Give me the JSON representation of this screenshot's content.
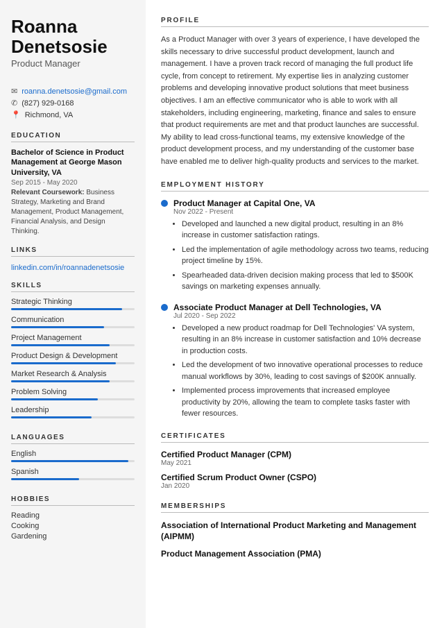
{
  "sidebar": {
    "name": "Roanna Denetsosie",
    "first_name": "Roanna",
    "last_name": "Denetsosie",
    "title": "Product Manager",
    "contact": {
      "email": "roanna.denetsosie@gmail.com",
      "phone": "(827) 929-0168",
      "location": "Richmond, VA"
    },
    "education_title": "EDUCATION",
    "education": {
      "degree": "Bachelor of Science in Product Management at George Mason University, VA",
      "dates": "Sep 2015 - May 2020",
      "coursework_label": "Relevant Coursework:",
      "coursework": "Business Strategy, Marketing and Brand Management, Product Management, Financial Analysis, and Design Thinking."
    },
    "links_title": "LINKS",
    "links": [
      {
        "label": "linkedin.com/in/roannadenetsosie",
        "url": "https://linkedin.com/in/roannadenetsosie"
      }
    ],
    "skills_title": "SKILLS",
    "skills": [
      {
        "name": "Strategic Thinking",
        "pct": 90
      },
      {
        "name": "Communication",
        "pct": 75
      },
      {
        "name": "Project Management",
        "pct": 80
      },
      {
        "name": "Product Design & Development",
        "pct": 85
      },
      {
        "name": "Market Research & Analysis",
        "pct": 80
      },
      {
        "name": "Problem Solving",
        "pct": 70
      },
      {
        "name": "Leadership",
        "pct": 65
      }
    ],
    "languages_title": "LANGUAGES",
    "languages": [
      {
        "name": "English",
        "pct": 95
      },
      {
        "name": "Spanish",
        "pct": 55
      }
    ],
    "hobbies_title": "HOBBIES",
    "hobbies": [
      "Reading",
      "Cooking",
      "Gardening"
    ]
  },
  "main": {
    "profile_title": "PROFILE",
    "profile_text": "As a Product Manager with over 3 years of experience, I have developed the skills necessary to drive successful product development, launch and management. I have a proven track record of managing the full product life cycle, from concept to retirement. My expertise lies in analyzing customer problems and developing innovative product solutions that meet business objectives. I am an effective communicator who is able to work with all stakeholders, including engineering, marketing, finance and sales to ensure that product requirements are met and that product launches are successful. My ability to lead cross-functional teams, my extensive knowledge of the product development process, and my understanding of the customer base have enabled me to deliver high-quality products and services to the market.",
    "employment_title": "EMPLOYMENT HISTORY",
    "jobs": [
      {
        "title": "Product Manager at Capital One, VA",
        "dates": "Nov 2022 - Present",
        "bullets": [
          "Developed and launched a new digital product, resulting in an 8% increase in customer satisfaction ratings.",
          "Led the implementation of agile methodology across two teams, reducing project timeline by 15%.",
          "Spearheaded data-driven decision making process that led to $500K savings on marketing expenses annually."
        ]
      },
      {
        "title": "Associate Product Manager at Dell Technologies, VA",
        "dates": "Jul 2020 - Sep 2022",
        "bullets": [
          "Developed a new product roadmap for Dell Technologies' VA system, resulting in an 8% increase in customer satisfaction and 10% decrease in production costs.",
          "Led the development of two innovative operational processes to reduce manual workflows by 30%, leading to cost savings of $200K annually.",
          "Implemented process improvements that increased employee productivity by 20%, allowing the team to complete tasks faster with fewer resources."
        ]
      }
    ],
    "certificates_title": "CERTIFICATES",
    "certificates": [
      {
        "name": "Certified Product Manager (CPM)",
        "date": "May 2021"
      },
      {
        "name": "Certified Scrum Product Owner (CSPO)",
        "date": "Jan 2020"
      }
    ],
    "memberships_title": "MEMBERSHIPS",
    "memberships": [
      {
        "name": "Association of International Product Marketing and Management (AIPMM)"
      },
      {
        "name": "Product Management Association (PMA)"
      }
    ]
  }
}
